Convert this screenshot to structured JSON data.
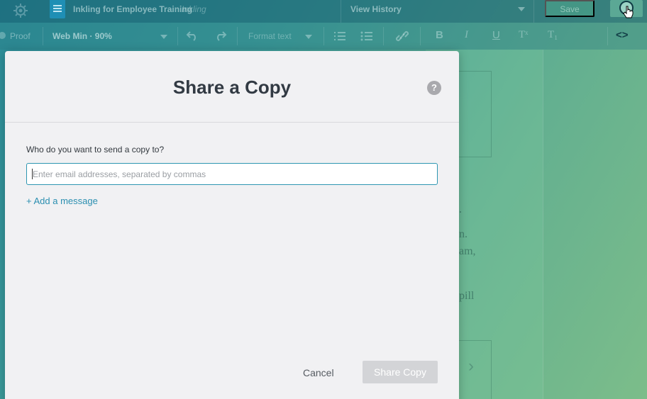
{
  "topbar": {
    "project_title": "Inkling for Employee Training",
    "project_sub": "Inkling",
    "view_history_label": "View History",
    "save_label": "Save"
  },
  "toolbar": {
    "proof_label": "Proof",
    "view_mode": "Web Min · 90%",
    "format_text_label": "Format text",
    "bold_glyph": "B",
    "italic_glyph": "I",
    "underline_glyph": "U",
    "superscript_glyph": "Tˣ",
    "subscript_glyph": "T₁",
    "code_glyph": "<>"
  },
  "background_doc": {
    "fragments": [
      ".",
      "n.",
      "am,",
      "pill"
    ]
  },
  "modal": {
    "title": "Share a Copy",
    "help_glyph": "?",
    "field_label": "Who do you want to send a copy to?",
    "email_value": "",
    "email_placeholder": "Enter email addresses, separated by commas",
    "add_message_label": "+ Add a message",
    "cancel_label": "Cancel",
    "share_label": "Share Copy"
  },
  "colors": {
    "accent": "#2b8fb0",
    "input_border": "#2e96b1",
    "disabled_button": "#d3d4d7",
    "modal_bg": "#f1f1f3",
    "title_text": "#323a43"
  },
  "icons": {
    "app_logo": "gear-icon",
    "document": "document-icon",
    "user": "user-icon",
    "undo": "undo-icon",
    "redo": "redo-icon",
    "ordered_list": "ordered-list-icon",
    "bullet_list": "bullet-list-icon",
    "link": "link-icon",
    "help": "help-icon"
  }
}
